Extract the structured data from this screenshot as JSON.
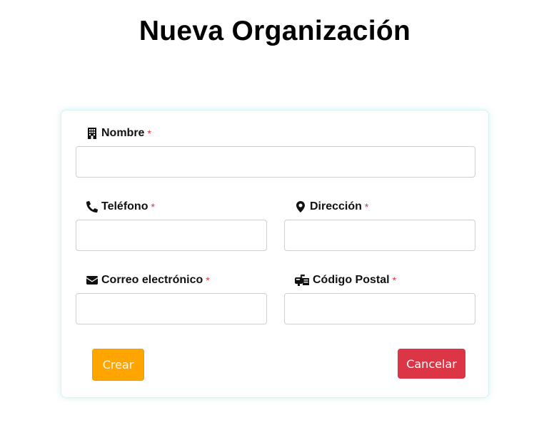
{
  "page": {
    "title": "Nueva Organización"
  },
  "form": {
    "required_marker": "*",
    "fields": {
      "nombre": {
        "label": "Nombre",
        "icon": "building-icon",
        "value": "",
        "placeholder": ""
      },
      "telefono": {
        "label": "Teléfono",
        "icon": "phone-icon",
        "value": "",
        "placeholder": ""
      },
      "direccion": {
        "label": "Dirección",
        "icon": "map-marker-icon",
        "value": "",
        "placeholder": ""
      },
      "correo": {
        "label": "Correo electrónico",
        "icon": "envelope-icon",
        "value": "",
        "placeholder": ""
      },
      "codigo_postal": {
        "label": "Código Postal",
        "icon": "mailbox-icon",
        "value": "",
        "placeholder": ""
      }
    },
    "buttons": {
      "crear": "Crear",
      "cancelar": "Cancelar"
    }
  },
  "colors": {
    "required": "#dc3545",
    "crear_button": "#ffa500",
    "cancelar_button": "#dc3545",
    "card_border": "#d9f3f3"
  }
}
